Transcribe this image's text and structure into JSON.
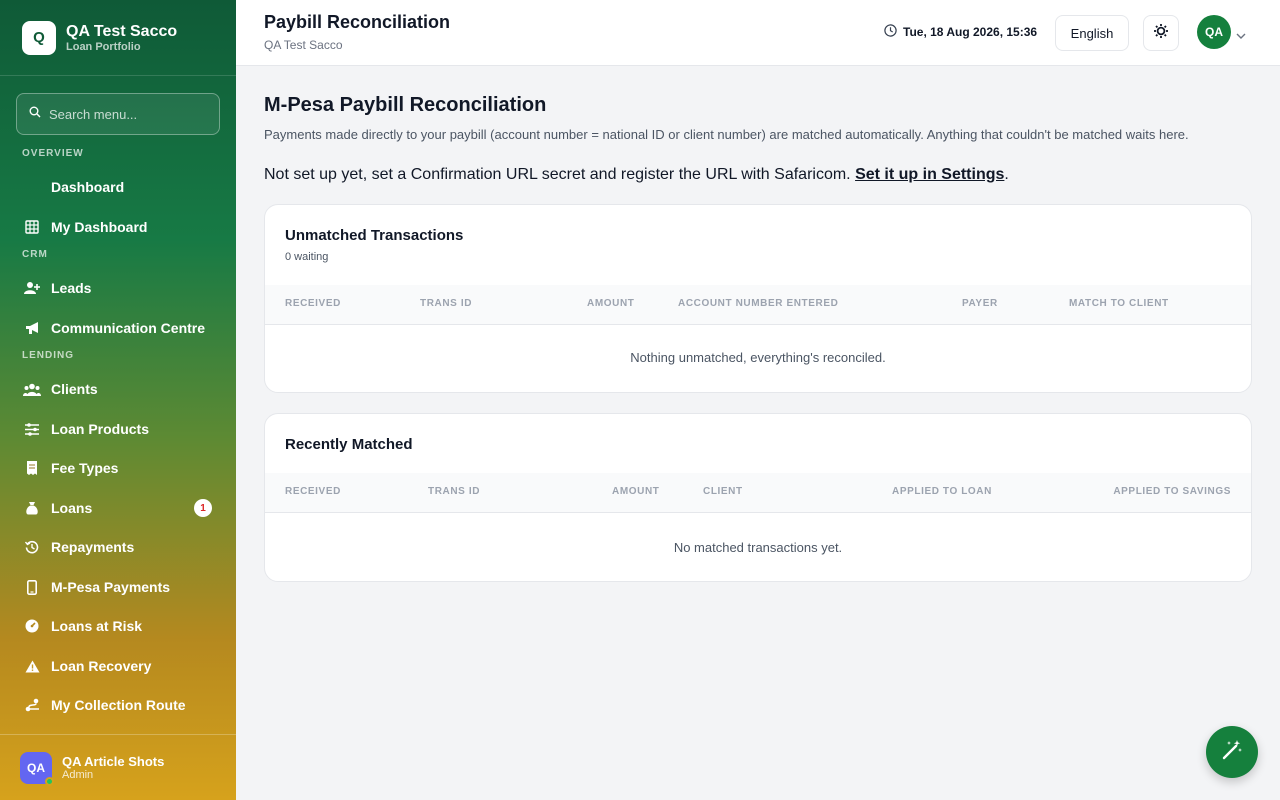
{
  "sidebar": {
    "brand_initial": "Q",
    "brand_name": "QA Test Sacco",
    "brand_sub": "Loan Portfolio",
    "search_placeholder": "Search menu...",
    "sections": {
      "overview": "OVERVIEW",
      "crm": "CRM",
      "lending": "LENDING"
    },
    "items": {
      "dashboard": "Dashboard",
      "my_dashboard": "My Dashboard",
      "leads": "Leads",
      "communication": "Communication Centre",
      "clients": "Clients",
      "loan_products": "Loan Products",
      "fee_types": "Fee Types",
      "loans": "Loans",
      "loans_badge": "1",
      "repayments": "Repayments",
      "mpesa": "M-Pesa Payments",
      "at_risk": "Loans at Risk",
      "recovery": "Loan Recovery",
      "collection_route": "My Collection Route"
    },
    "user": {
      "initials": "QA",
      "name": "QA Article Shots",
      "role": "Admin"
    }
  },
  "header": {
    "title": "Paybill Reconciliation",
    "subtitle": "QA Test Sacco",
    "datetime": "Tue, 18 Aug 2026, 15:36",
    "language": "English",
    "avatar": "QA"
  },
  "main": {
    "title": "M-Pesa Paybill Reconciliation",
    "description": "Payments made directly to your paybill (account number = national ID or client number) are matched automatically. Anything that couldn't be matched waits here.",
    "notice_text": "Not set up yet, set a Confirmation URL secret and register the URL with Safaricom. ",
    "notice_link": "Set it up in Settings",
    "notice_end": "."
  },
  "unmatched": {
    "title": "Unmatched Transactions",
    "subtitle": "0 waiting",
    "columns": [
      "RECEIVED",
      "TRANS ID",
      "AMOUNT",
      "ACCOUNT NUMBER ENTERED",
      "PAYER",
      "MATCH TO CLIENT"
    ],
    "empty": "Nothing unmatched, everything's reconciled."
  },
  "matched": {
    "title": "Recently Matched",
    "columns": [
      "RECEIVED",
      "TRANS ID",
      "AMOUNT",
      "CLIENT",
      "APPLIED TO LOAN",
      "APPLIED TO SAVINGS"
    ],
    "empty": "No matched transactions yet."
  },
  "colors": {
    "brand_green": "#15803d",
    "sidebar_top": "#0f5a37",
    "sidebar_bottom": "#d6a21c"
  }
}
